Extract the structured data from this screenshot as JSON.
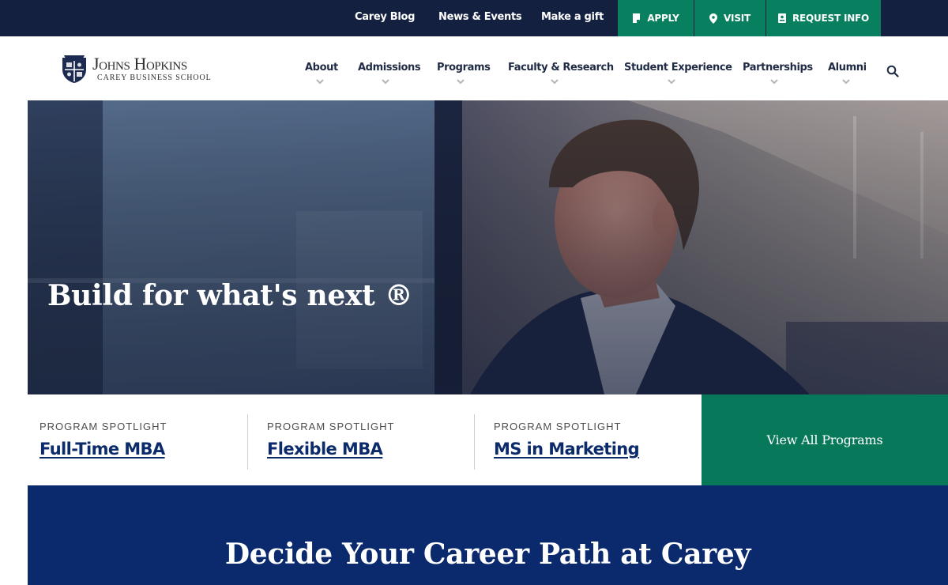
{
  "utility_bar": {
    "links": [
      {
        "label": "Carey Blog"
      },
      {
        "label": "News & Events"
      },
      {
        "label": "Make a gift"
      }
    ],
    "cta": [
      {
        "label": "APPLY",
        "icon": "document-icon"
      },
      {
        "label": "VISIT",
        "icon": "map-pin-icon"
      },
      {
        "label": "REQUEST INFO",
        "icon": "badge-icon"
      }
    ],
    "colors": {
      "bar": "#14203f",
      "cta": "#08805f"
    }
  },
  "header": {
    "logo": {
      "name": "Johns Hopkins",
      "subtitle": "Carey Business School",
      "icon": "university-shield-icon"
    },
    "nav": [
      {
        "label": "About"
      },
      {
        "label": "Admissions"
      },
      {
        "label": "Programs"
      },
      {
        "label": "Faculty & Research"
      },
      {
        "label": "Student Experience"
      },
      {
        "label": "Partnerships"
      },
      {
        "label": "Alumni"
      }
    ],
    "search_icon": "search-icon"
  },
  "hero": {
    "title": "Build for what's next ®"
  },
  "spotlights": {
    "items": [
      {
        "kicker": "PROGRAM SPOTLIGHT",
        "title": "Full-Time MBA"
      },
      {
        "kicker": "PROGRAM SPOTLIGHT",
        "title": "Flexible MBA"
      },
      {
        "kicker": "PROGRAM SPOTLIGHT",
        "title": "MS in Marketing"
      }
    ],
    "view_all": "View All Programs"
  },
  "career": {
    "title": "Decide Your Career Path at Carey"
  },
  "colors": {
    "navy": "#14203f",
    "green": "#08785b",
    "royal": "#0b2a6e",
    "link": "#0c2b6b"
  }
}
